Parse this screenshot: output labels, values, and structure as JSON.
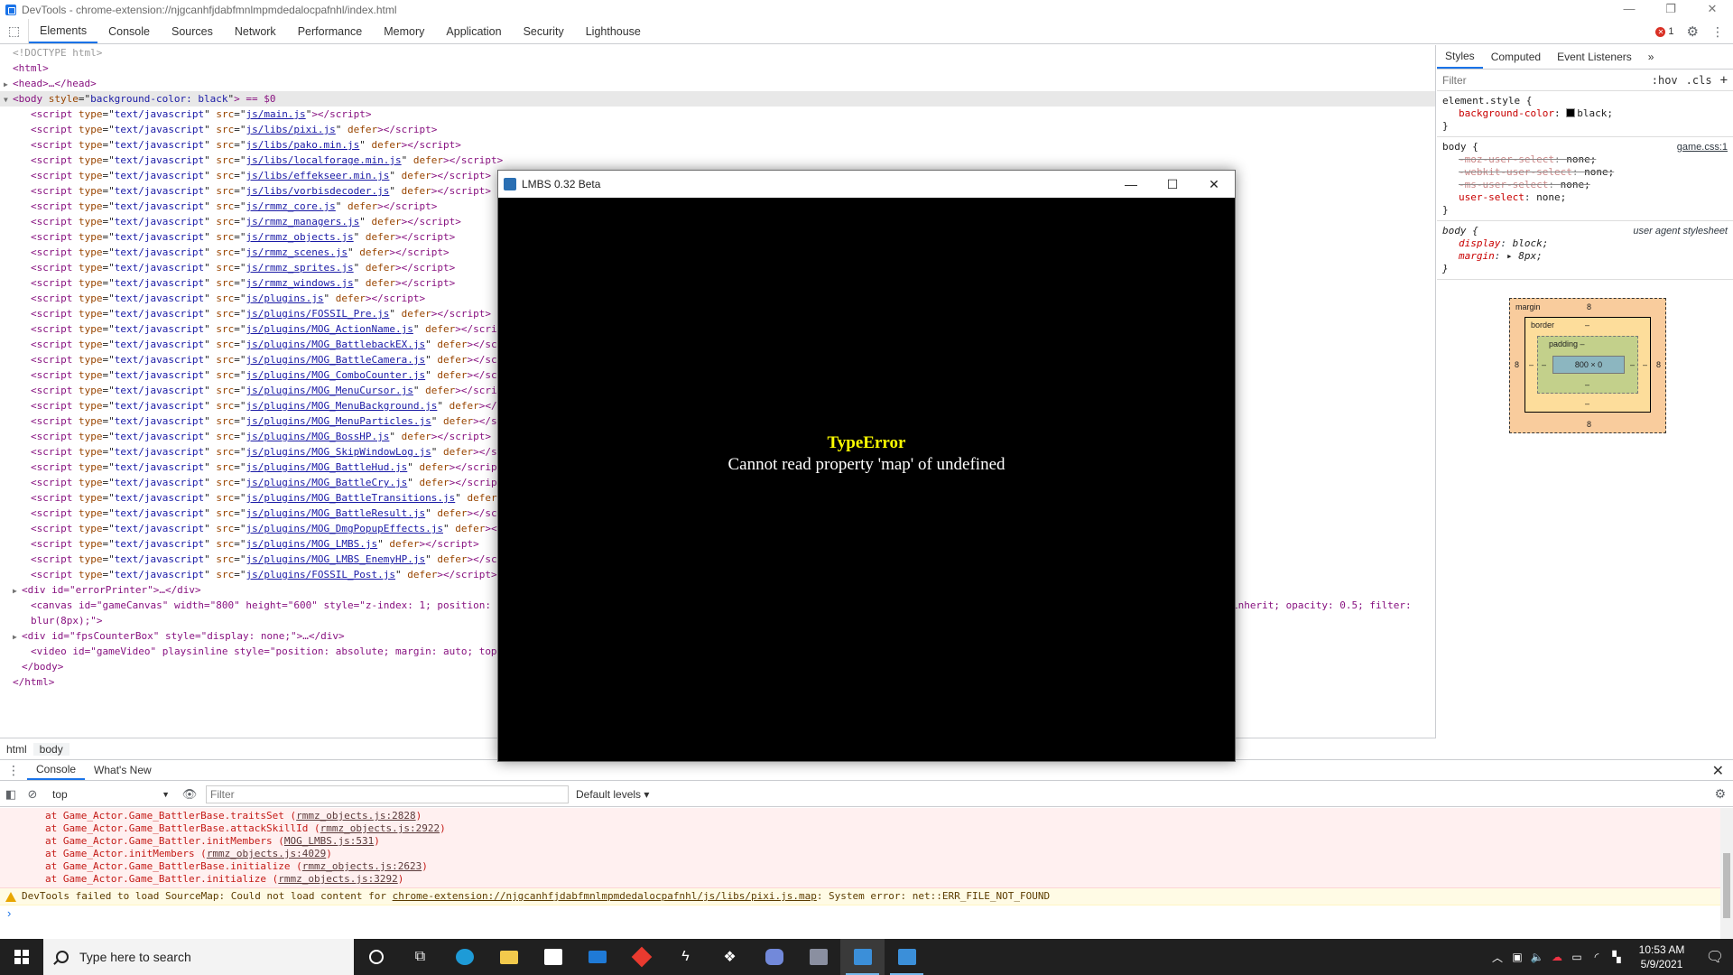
{
  "window": {
    "title": "DevTools - chrome-extension://njgcanhfjdabfmnlmpmdedalocpafnhl/index.html"
  },
  "devtools": {
    "tabs": [
      "Elements",
      "Console",
      "Sources",
      "Network",
      "Performance",
      "Memory",
      "Application",
      "Security",
      "Lighthouse"
    ],
    "active_tab": "Elements",
    "error_count": "1"
  },
  "elements": {
    "doctype": "<!DOCTYPE html>",
    "html_open": "<html>",
    "head": "<head>…</head>",
    "body_open_tag": "<body",
    "body_attr_name": "style",
    "body_attr_value": "background-color: black",
    "body_suffix": "> == $0",
    "scripts": [
      {
        "src": "js/main.js",
        "defer": false
      },
      {
        "src": "js/libs/pixi.js",
        "defer": true
      },
      {
        "src": "js/libs/pako.min.js",
        "defer": true
      },
      {
        "src": "js/libs/localforage.min.js",
        "defer": true
      },
      {
        "src": "js/libs/effekseer.min.js",
        "defer": true
      },
      {
        "src": "js/libs/vorbisdecoder.js",
        "defer": true
      },
      {
        "src": "js/rmmz_core.js",
        "defer": true
      },
      {
        "src": "js/rmmz_managers.js",
        "defer": true
      },
      {
        "src": "js/rmmz_objects.js",
        "defer": true
      },
      {
        "src": "js/rmmz_scenes.js",
        "defer": true
      },
      {
        "src": "js/rmmz_sprites.js",
        "defer": true
      },
      {
        "src": "js/rmmz_windows.js",
        "defer": true
      },
      {
        "src": "js/plugins.js",
        "defer": true
      },
      {
        "src": "js/plugins/FOSSIL_Pre.js",
        "defer": true
      },
      {
        "src": "js/plugins/MOG_ActionName.js",
        "defer": true
      },
      {
        "src": "js/plugins/MOG_BattlebackEX.js",
        "defer": true
      },
      {
        "src": "js/plugins/MOG_BattleCamera.js",
        "defer": true
      },
      {
        "src": "js/plugins/MOG_ComboCounter.js",
        "defer": true
      },
      {
        "src": "js/plugins/MOG_MenuCursor.js",
        "defer": true
      },
      {
        "src": "js/plugins/MOG_MenuBackground.js",
        "defer": true
      },
      {
        "src": "js/plugins/MOG_MenuParticles.js",
        "defer": true
      },
      {
        "src": "js/plugins/MOG_BossHP.js",
        "defer": true
      },
      {
        "src": "js/plugins/MOG_SkipWindowLog.js",
        "defer": true
      },
      {
        "src": "js/plugins/MOG_BattleHud.js",
        "defer": true
      },
      {
        "src": "js/plugins/MOG_BattleCry.js",
        "defer": true
      },
      {
        "src": "js/plugins/MOG_BattleTransitions.js",
        "defer": true
      },
      {
        "src": "js/plugins/MOG_BattleResult.js",
        "defer": true
      },
      {
        "src": "js/plugins/MOG_DmgPopupEffects.js",
        "defer": true
      },
      {
        "src": "js/plugins/MOG_LMBS.js",
        "defer": true
      },
      {
        "src": "js/plugins/MOG_LMBS_EnemyHP.js",
        "defer": true
      },
      {
        "src": "js/plugins/FOSSIL_Post.js",
        "defer": true
      }
    ],
    "error_printer": "<div id=\"errorPrinter\">…</div>",
    "canvas_line": "<canvas id=\"gameCanvas\" width=\"800\" height=\"600\" style=\"z-index: 1; position:",
    "canvas_line_tail": "inherit; opacity: 0.5; filter:",
    "canvas_line_2": "blur(8px);\">",
    "fps_box": "<div id=\"fpsCounterBox\" style=\"display: none;\">…</div>",
    "video_line": "<video id=\"gameVideo\" playsinline style=\"position: absolute; margin: auto; top",
    "body_close": "</body>",
    "html_close": "</html>"
  },
  "breadcrumb": [
    "html",
    "body"
  ],
  "styles": {
    "tabs": [
      "Styles",
      "Computed",
      "Event Listeners"
    ],
    "more": "»",
    "filter_placeholder": "Filter",
    "hov": ":hov",
    "cls": ".cls",
    "add": "+",
    "rule_element": {
      "selector": "element.style {",
      "prop": "background-color",
      "value": "black;",
      "close": "}"
    },
    "rule_body": {
      "selector": "body {",
      "source": "game.css:1",
      "decls": [
        {
          "prop": "-moz-user-select",
          "value": "none;",
          "struck": true
        },
        {
          "prop": "-webkit-user-select",
          "value": "none;",
          "struck": true
        },
        {
          "prop": "-ms-user-select",
          "value": "none;",
          "struck": true
        },
        {
          "prop": "user-select",
          "value": "none;",
          "struck": false
        }
      ],
      "close": "}"
    },
    "rule_ua": {
      "selector": "body {",
      "source": "user agent stylesheet",
      "decls": [
        {
          "prop": "display",
          "value": "block;"
        },
        {
          "prop": "margin",
          "value": "▸ 8px;"
        }
      ],
      "close": "}"
    },
    "boxmodel": {
      "margin_label": "margin",
      "margin_top": "8",
      "margin_bottom": "8",
      "margin_left": "8",
      "margin_right": "8",
      "border_label": "border",
      "border_top": "–",
      "border_bottom": "–",
      "border_left": "–",
      "border_right": "–",
      "padding_label": "padding –",
      "padding_bottom": "–",
      "padding_left": "–",
      "padding_right": "–",
      "content": "800 × 0"
    }
  },
  "drawer": {
    "tabs": [
      "Console",
      "What's New"
    ],
    "active_tab": "Console",
    "context": "top",
    "filter_placeholder": "Filter",
    "levels": "Default levels ▾"
  },
  "console": {
    "stack": [
      {
        "text": "at Game_Actor.Game_BattlerBase.traitsSet (",
        "link": "rmmz_objects.js:2828"
      },
      {
        "text": "at Game_Actor.Game_BattlerBase.attackSkillId (",
        "link": "rmmz_objects.js:2922"
      },
      {
        "text": "at Game_Actor.Game_Battler.initMembers (",
        "link": "MOG_LMBS.js:531"
      },
      {
        "text": "at Game_Actor.initMembers (",
        "link": "rmmz_objects.js:4029"
      },
      {
        "text": "at Game_Actor.Game_BattlerBase.initialize (",
        "link": "rmmz_objects.js:2623"
      },
      {
        "text": "at Game_Actor.Game_Battler.initialize (",
        "link": "rmmz_objects.js:3292"
      }
    ],
    "warning_prefix": "DevTools failed to load SourceMap: Could not load content for ",
    "warning_link": "chrome-extension://njgcanhfjdabfmnlmpmdedalocpafnhl/js/libs/pixi.js.map",
    "warning_suffix": ": System error: net::ERR_FILE_NOT_FOUND",
    "prompt": "›"
  },
  "game": {
    "title": "LMBS 0.32 Beta",
    "error_type": "TypeError",
    "error_message": "Cannot read property 'map' of undefined"
  },
  "taskbar": {
    "search_placeholder": "Type here to search",
    "time": "10:53 AM",
    "date": "5/9/2021"
  },
  "colors": {
    "accent": "#1a73e8",
    "error_title": "#ffff00",
    "console_error": "#c41a16"
  }
}
